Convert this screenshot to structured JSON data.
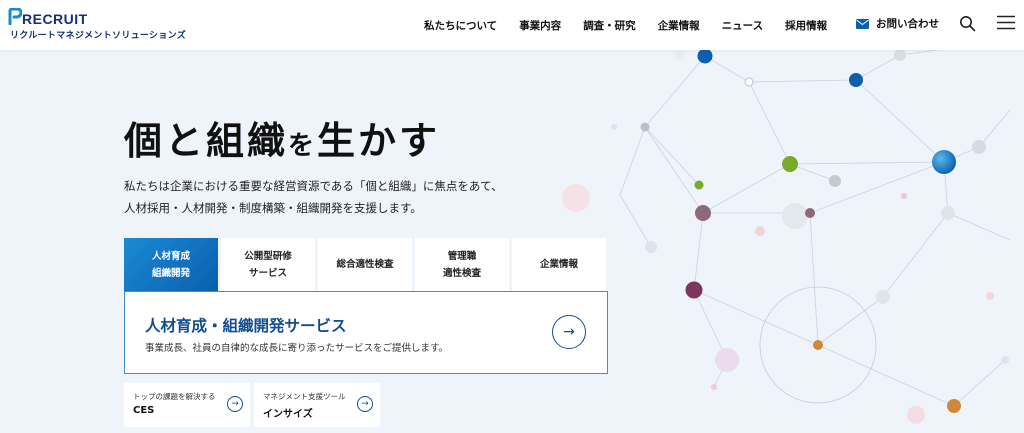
{
  "header": {
    "logo_text": "RECRUIT",
    "logo_sub": "リクルートマネジメントソリューションズ",
    "nav": [
      {
        "label": "私たちについて"
      },
      {
        "label": "事業内容"
      },
      {
        "label": "調査・研究"
      },
      {
        "label": "企業情報"
      },
      {
        "label": "ニュース"
      },
      {
        "label": "採用情報"
      }
    ],
    "contact_label": "お問い合わせ",
    "icons": {
      "mail": "mail-icon",
      "search": "search-icon",
      "menu": "hamburger-menu-icon"
    }
  },
  "hero": {
    "title_part1": "個と組織",
    "title_part2": "を",
    "title_part3": "生かす",
    "desc_line1": "私たちは企業における重要な経営資源である「個と組織」に焦点をあて、",
    "desc_line2": "人材採用・人材開発・制度構築・組織開発を支援します。"
  },
  "tabs": [
    {
      "line1": "人材育成",
      "line2": "組織開発",
      "active": true
    },
    {
      "line1": "公開型研修",
      "line2": "サービス",
      "active": false
    },
    {
      "line1": "総合適性検査",
      "line2": "",
      "active": false
    },
    {
      "line1": "管理職",
      "line2": "適性検査",
      "active": false
    },
    {
      "line1": "企業情報",
      "line2": "",
      "active": false
    }
  ],
  "panel": {
    "title": "人材育成・組織開発サービス",
    "desc": "事業成長、社員の自律的な成長に寄り添ったサービスをご提供します。",
    "arrow": "→"
  },
  "cards": [
    {
      "sub": "トップの課題を解決する",
      "title": "CES",
      "arrow": "→"
    },
    {
      "sub": "マネジメント支援ツール",
      "title": "インサイズ",
      "arrow": "→"
    }
  ],
  "colors": {
    "brand_navy": "#13307a",
    "accent_blue": "#0a5fae",
    "panel_title": "#124e8f",
    "background": "#eef4fa"
  }
}
